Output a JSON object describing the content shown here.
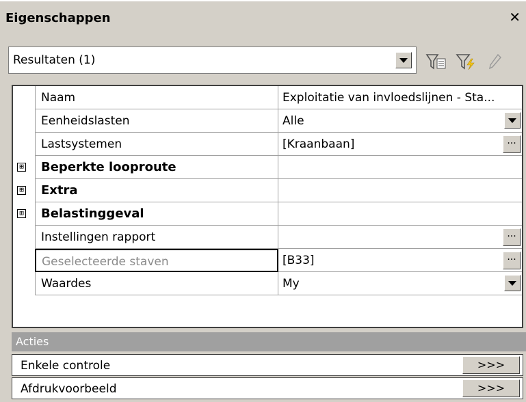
{
  "panel": {
    "title": "Eigenschappen",
    "close_icon": "close-icon"
  },
  "selector": {
    "value": "Resultaten (1)"
  },
  "toolbar": {
    "icons": [
      "filter-list-icon",
      "filter-lightning-icon",
      "pencil-icon"
    ]
  },
  "properties": [
    {
      "name": "Naam",
      "value": "Exploitatie van invloedslijnen - Sta...",
      "control": "none"
    },
    {
      "name": "Eenheidslasten",
      "value": "Alle",
      "control": "dropdown"
    },
    {
      "name": "Lastsystemen",
      "value": "[Kraanbaan]",
      "control": "ellipsis"
    },
    {
      "name": "Beperkte looproute",
      "value": "",
      "control": "none",
      "group": true,
      "expander": "⊞"
    },
    {
      "name": "Extra",
      "value": "",
      "control": "none",
      "group": true,
      "expander": "⊞"
    },
    {
      "name": "Belastinggeval",
      "value": "",
      "control": "none",
      "group": true,
      "expander": "⊞"
    },
    {
      "name": "Instellingen rapport",
      "value": "",
      "control": "ellipsis"
    },
    {
      "name": "Geselecteerde staven",
      "value": "[B33]",
      "control": "ellipsis",
      "state": "selected-disabled"
    },
    {
      "name": "Waardes",
      "value": "My",
      "control": "dropdown"
    }
  ],
  "actions": {
    "header": "Acties",
    "items": [
      {
        "label": "Enkele controle",
        "button": ">>>"
      },
      {
        "label": "Afdrukvoorbeeld",
        "button": ">>>"
      }
    ]
  },
  "ellipsis_label": "..."
}
